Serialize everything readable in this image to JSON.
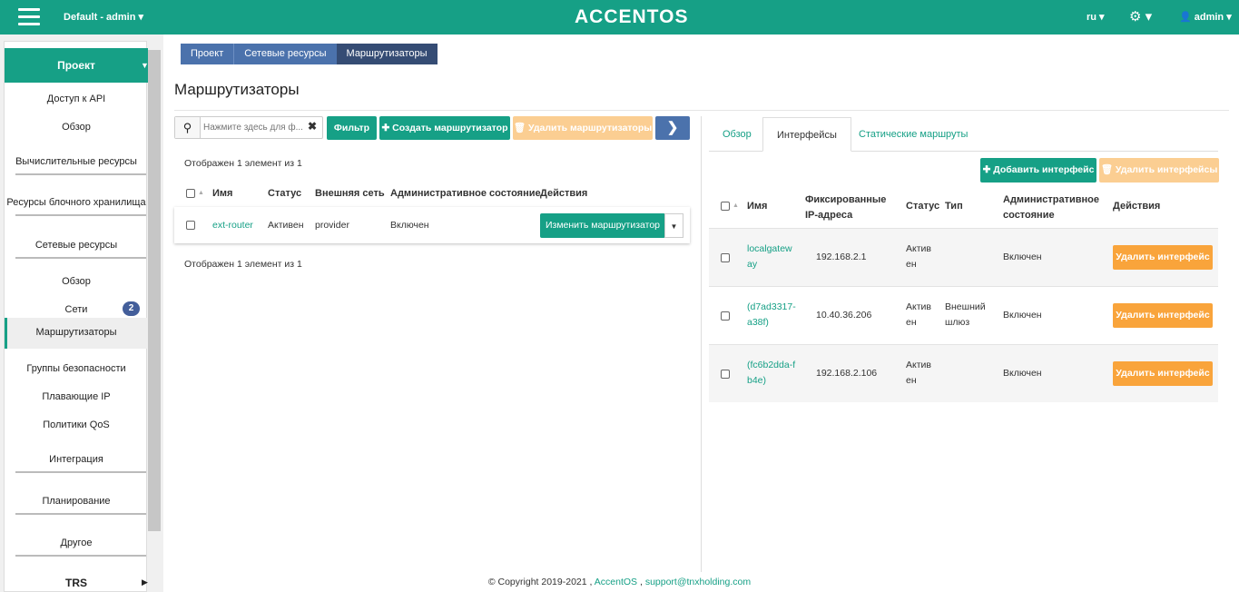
{
  "topbar": {
    "project_selector": "Default - admin ▾",
    "logo": "ACCENTOS",
    "language": "ru ▾",
    "settings": "⚙ ▾",
    "user": "👤 admin ▾"
  },
  "sidebar": {
    "project_label": "Проект",
    "items": [
      "Доступ к API",
      "Обзор",
      "Вычислительные ресурсы",
      "Ресурсы блочного хранилища",
      "Сетевые ресурсы"
    ],
    "network_items": [
      "Обзор",
      "Сети",
      "Маршрутизаторы",
      "Группы безопасности",
      "Плавающие IP",
      "Политики QoS"
    ],
    "networks_badge": "2",
    "bottom_items": [
      "Интеграция",
      "Планирование",
      "Другое",
      "TRS"
    ]
  },
  "breadcrumb": [
    "Проект",
    "Сетевые ресурсы",
    "Маршрутизаторы"
  ],
  "page_title": "Маршрутизаторы",
  "toolbar": {
    "search_placeholder": "Нажмите здесь для ф...",
    "filter": "Фильтр",
    "create": "✚ Создать маршрутизатор",
    "delete": "🗑 Удалить маршрутизаторы",
    "next": "❯"
  },
  "routers": {
    "count_text": "Отображен 1 элемент из 1",
    "headers": [
      "Имя",
      "Статус",
      "Внешняя сеть",
      "Административное состояние",
      "Действия"
    ],
    "rows": [
      {
        "name": "ext-router",
        "status": "Активен",
        "network": "provider",
        "admin": "Включен",
        "action": "Изменить маршрутизатор"
      }
    ]
  },
  "detail": {
    "tabs": [
      "Обзор",
      "Интерфейсы",
      "Статические маршруты"
    ],
    "add_interface": "✚ Добавить интерфейс",
    "delete_interfaces": "🗑 Удалить интерфейсы",
    "headers": [
      "Имя",
      "Фиксированные IP-адреса",
      "Статус",
      "Тип",
      "Административное состояние",
      "Действия"
    ],
    "rows": [
      {
        "name": "localgateway",
        "ip": "192.168.2.1",
        "status": "Активен",
        "type": "",
        "admin": "Включен",
        "action": "Удалить интерфейс"
      },
      {
        "name": "(d7ad3317-a38f)",
        "ip": "10.40.36.206",
        "status": "Активен",
        "type": "Внешний шлюз",
        "admin": "Включен",
        "action": "Удалить интерфейс"
      },
      {
        "name": "(fc6b2dda-fb4e)",
        "ip": "192.168.2.106",
        "status": "Активен",
        "type": "",
        "admin": "Включен",
        "action": "Удалить интерфейс"
      }
    ]
  },
  "footer": {
    "copyright": "© Copyright 2019-2021 ,",
    "brand": "AccentOS",
    "sep": ",",
    "email": "support@tnxholding.com"
  }
}
